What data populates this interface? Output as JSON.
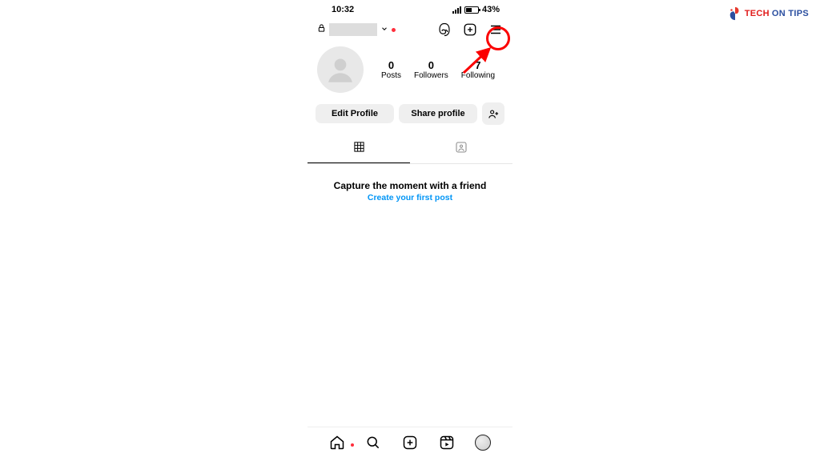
{
  "watermark": {
    "brand_red": "TECH",
    "brand_blue": "ON TIPS"
  },
  "statusbar": {
    "time": "10:32",
    "battery_pct": "43%"
  },
  "topbar": {
    "username_redacted": "",
    "threads_icon": "threads-icon",
    "create_icon": "plus-square-icon",
    "menu_icon": "hamburger-icon"
  },
  "profile": {
    "stats": {
      "posts": {
        "count": "0",
        "label": "Posts"
      },
      "followers": {
        "count": "0",
        "label": "Followers"
      },
      "following": {
        "count": "7",
        "label": "Following"
      }
    }
  },
  "actions": {
    "edit_profile": "Edit Profile",
    "share_profile": "Share profile"
  },
  "empty": {
    "title": "Capture the moment with a friend",
    "link": "Create your first post"
  },
  "tabs": {
    "grid": "grid-tab",
    "tagged": "tagged-tab"
  }
}
